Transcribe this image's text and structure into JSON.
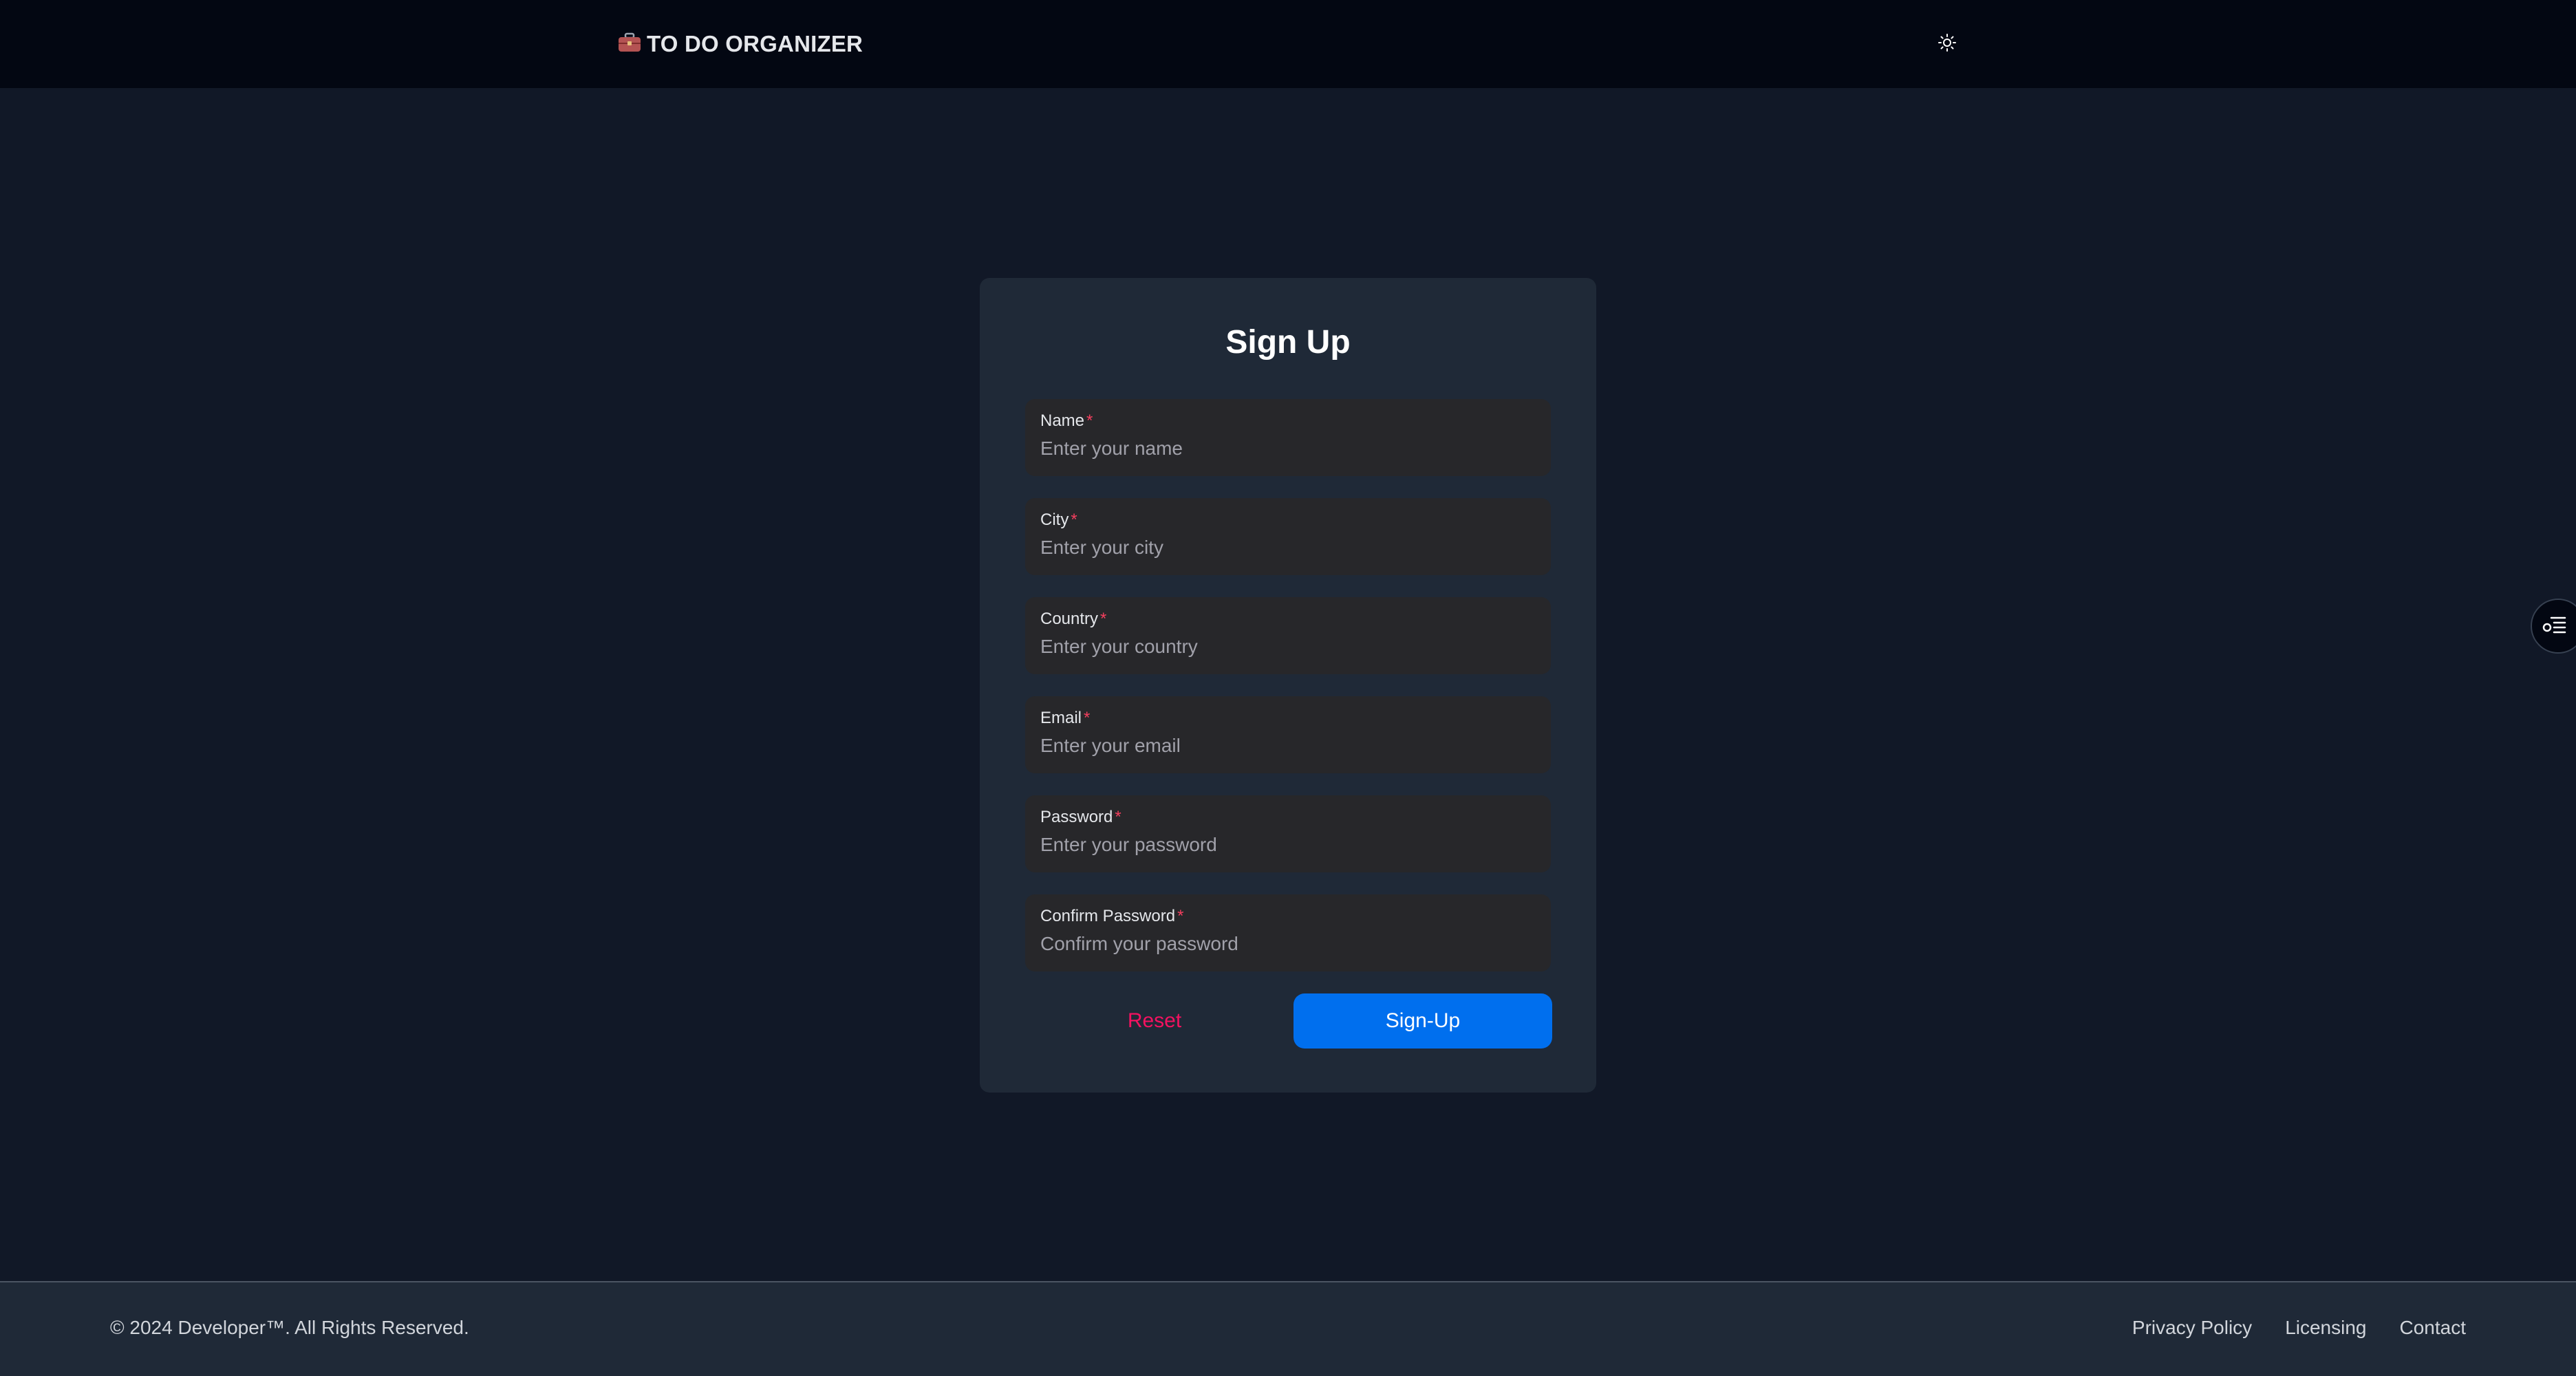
{
  "header": {
    "brand_icon": "briefcase-icon",
    "brand_title": "TO DO ORGANIZER",
    "theme_toggle_icon": "sun-icon"
  },
  "form": {
    "title": "Sign Up",
    "required_marker": "*",
    "fields": [
      {
        "label": "Name",
        "placeholder": "Enter your name"
      },
      {
        "label": "City",
        "placeholder": "Enter your city"
      },
      {
        "label": "Country",
        "placeholder": "Enter your country"
      },
      {
        "label": "Email",
        "placeholder": "Enter your email"
      },
      {
        "label": "Password",
        "placeholder": "Enter your password"
      },
      {
        "label": "Confirm Password",
        "placeholder": "Confirm your password"
      }
    ],
    "reset_label": "Reset",
    "submit_label": "Sign-Up"
  },
  "side_button": {
    "icon": "settings-list-icon"
  },
  "footer": {
    "copyright": "© 2024 Developer™. All Rights Reserved.",
    "links": [
      "Privacy Policy",
      "Licensing",
      "Contact"
    ]
  },
  "colors": {
    "background": "#111827",
    "header": "#030712",
    "card": "#1f2937",
    "field": "#27272a",
    "primary": "#006fee",
    "danger": "#f31260"
  }
}
